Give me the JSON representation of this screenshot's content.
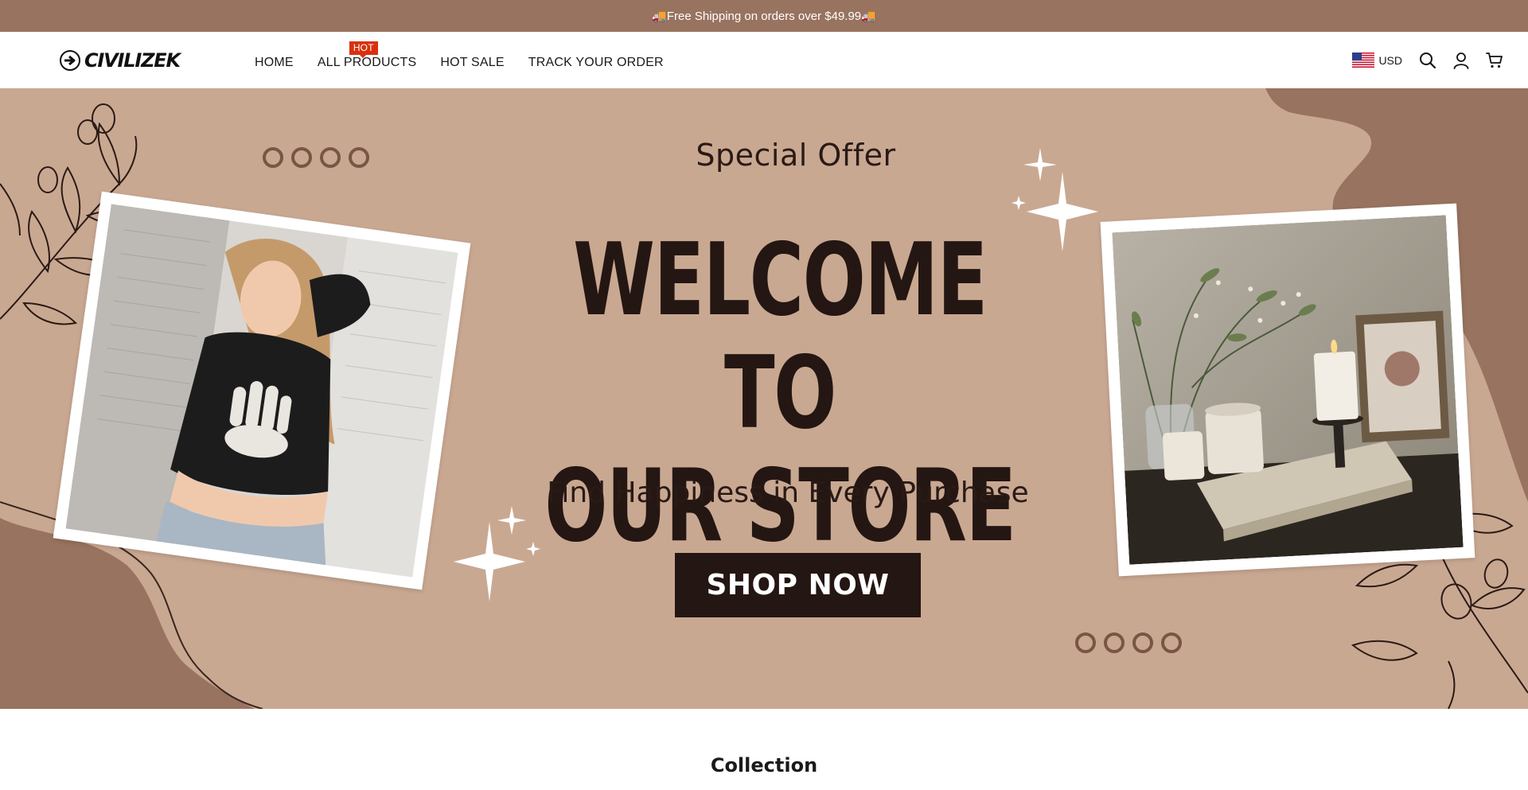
{
  "announcement": {
    "text": "🚚Free Shipping on orders over $49.99🚚"
  },
  "header": {
    "logo_text": "CIVILIZEK",
    "nav": [
      {
        "label": "HOME"
      },
      {
        "label": "ALL PRODUCTS",
        "badge": "HOT"
      },
      {
        "label": "HOT SALE"
      },
      {
        "label": "TRACK YOUR ORDER"
      }
    ],
    "currency": {
      "code": "USD",
      "flag": "us-flag"
    },
    "icons": [
      "search-icon",
      "account-icon",
      "cart-icon"
    ]
  },
  "hero": {
    "special_offer": "Special Offer",
    "headline_line1": "WELCOME TO",
    "headline_line2": "OUR STORE",
    "tagline": "Find Happiness in Every Purchase",
    "cta": "SHOP NOW",
    "colors": {
      "background": "#c9a892",
      "dark_brown": "#98735f",
      "text": "#241612"
    }
  },
  "section": {
    "collection_title": "Collection"
  },
  "colors": {
    "announcement_bg": "#98735f",
    "hot_badge": "#d9300f"
  }
}
